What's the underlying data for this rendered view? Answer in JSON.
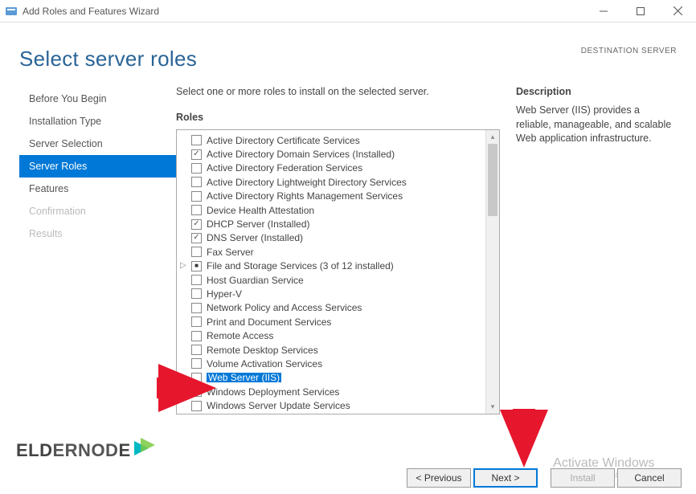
{
  "window": {
    "title": "Add Roles and Features Wizard"
  },
  "header": {
    "title": "Select server roles",
    "destination": "DESTINATION SERVER"
  },
  "sidebar": {
    "steps": [
      {
        "label": "Before You Begin",
        "state": "normal"
      },
      {
        "label": "Installation Type",
        "state": "normal"
      },
      {
        "label": "Server Selection",
        "state": "normal"
      },
      {
        "label": "Server Roles",
        "state": "active"
      },
      {
        "label": "Features",
        "state": "normal"
      },
      {
        "label": "Confirmation",
        "state": "disabled"
      },
      {
        "label": "Results",
        "state": "disabled"
      }
    ]
  },
  "main": {
    "instructions": "Select one or more roles to install on the selected server.",
    "roles_label": "Roles",
    "desc_label": "Description",
    "description": "Web Server (IIS) provides a reliable, manageable, and scalable Web application infrastructure.",
    "roles": [
      {
        "label": "Active Directory Certificate Services",
        "check": "none",
        "selected": false
      },
      {
        "label": "Active Directory Domain Services (Installed)",
        "check": "checked",
        "selected": false
      },
      {
        "label": "Active Directory Federation Services",
        "check": "none",
        "selected": false
      },
      {
        "label": "Active Directory Lightweight Directory Services",
        "check": "none",
        "selected": false
      },
      {
        "label": "Active Directory Rights Management Services",
        "check": "none",
        "selected": false
      },
      {
        "label": "Device Health Attestation",
        "check": "none",
        "selected": false
      },
      {
        "label": "DHCP Server (Installed)",
        "check": "checked",
        "selected": false
      },
      {
        "label": "DNS Server (Installed)",
        "check": "checked",
        "selected": false
      },
      {
        "label": "Fax Server",
        "check": "none",
        "selected": false
      },
      {
        "label": "File and Storage Services (3 of 12 installed)",
        "check": "partial",
        "selected": false,
        "expander": true
      },
      {
        "label": "Host Guardian Service",
        "check": "none",
        "selected": false
      },
      {
        "label": "Hyper-V",
        "check": "none",
        "selected": false
      },
      {
        "label": "Network Policy and Access Services",
        "check": "none",
        "selected": false
      },
      {
        "label": "Print and Document Services",
        "check": "none",
        "selected": false
      },
      {
        "label": "Remote Access",
        "check": "none",
        "selected": false
      },
      {
        "label": "Remote Desktop Services",
        "check": "none",
        "selected": false
      },
      {
        "label": "Volume Activation Services",
        "check": "none",
        "selected": false
      },
      {
        "label": "Web Server (IIS)",
        "check": "none",
        "selected": true
      },
      {
        "label": "Windows Deployment Services",
        "check": "none",
        "selected": false
      },
      {
        "label": "Windows Server Update Services",
        "check": "none",
        "selected": false
      }
    ]
  },
  "footer": {
    "previous": "< Previous",
    "next": "Next >",
    "install": "Install",
    "cancel": "Cancel"
  },
  "watermark": {
    "line1": "Activate Windows",
    "line2": "Go to Settings to activate Windows."
  },
  "logo": {
    "text1": "ELD",
    "text2": "ERNOD",
    "text3": "E"
  }
}
